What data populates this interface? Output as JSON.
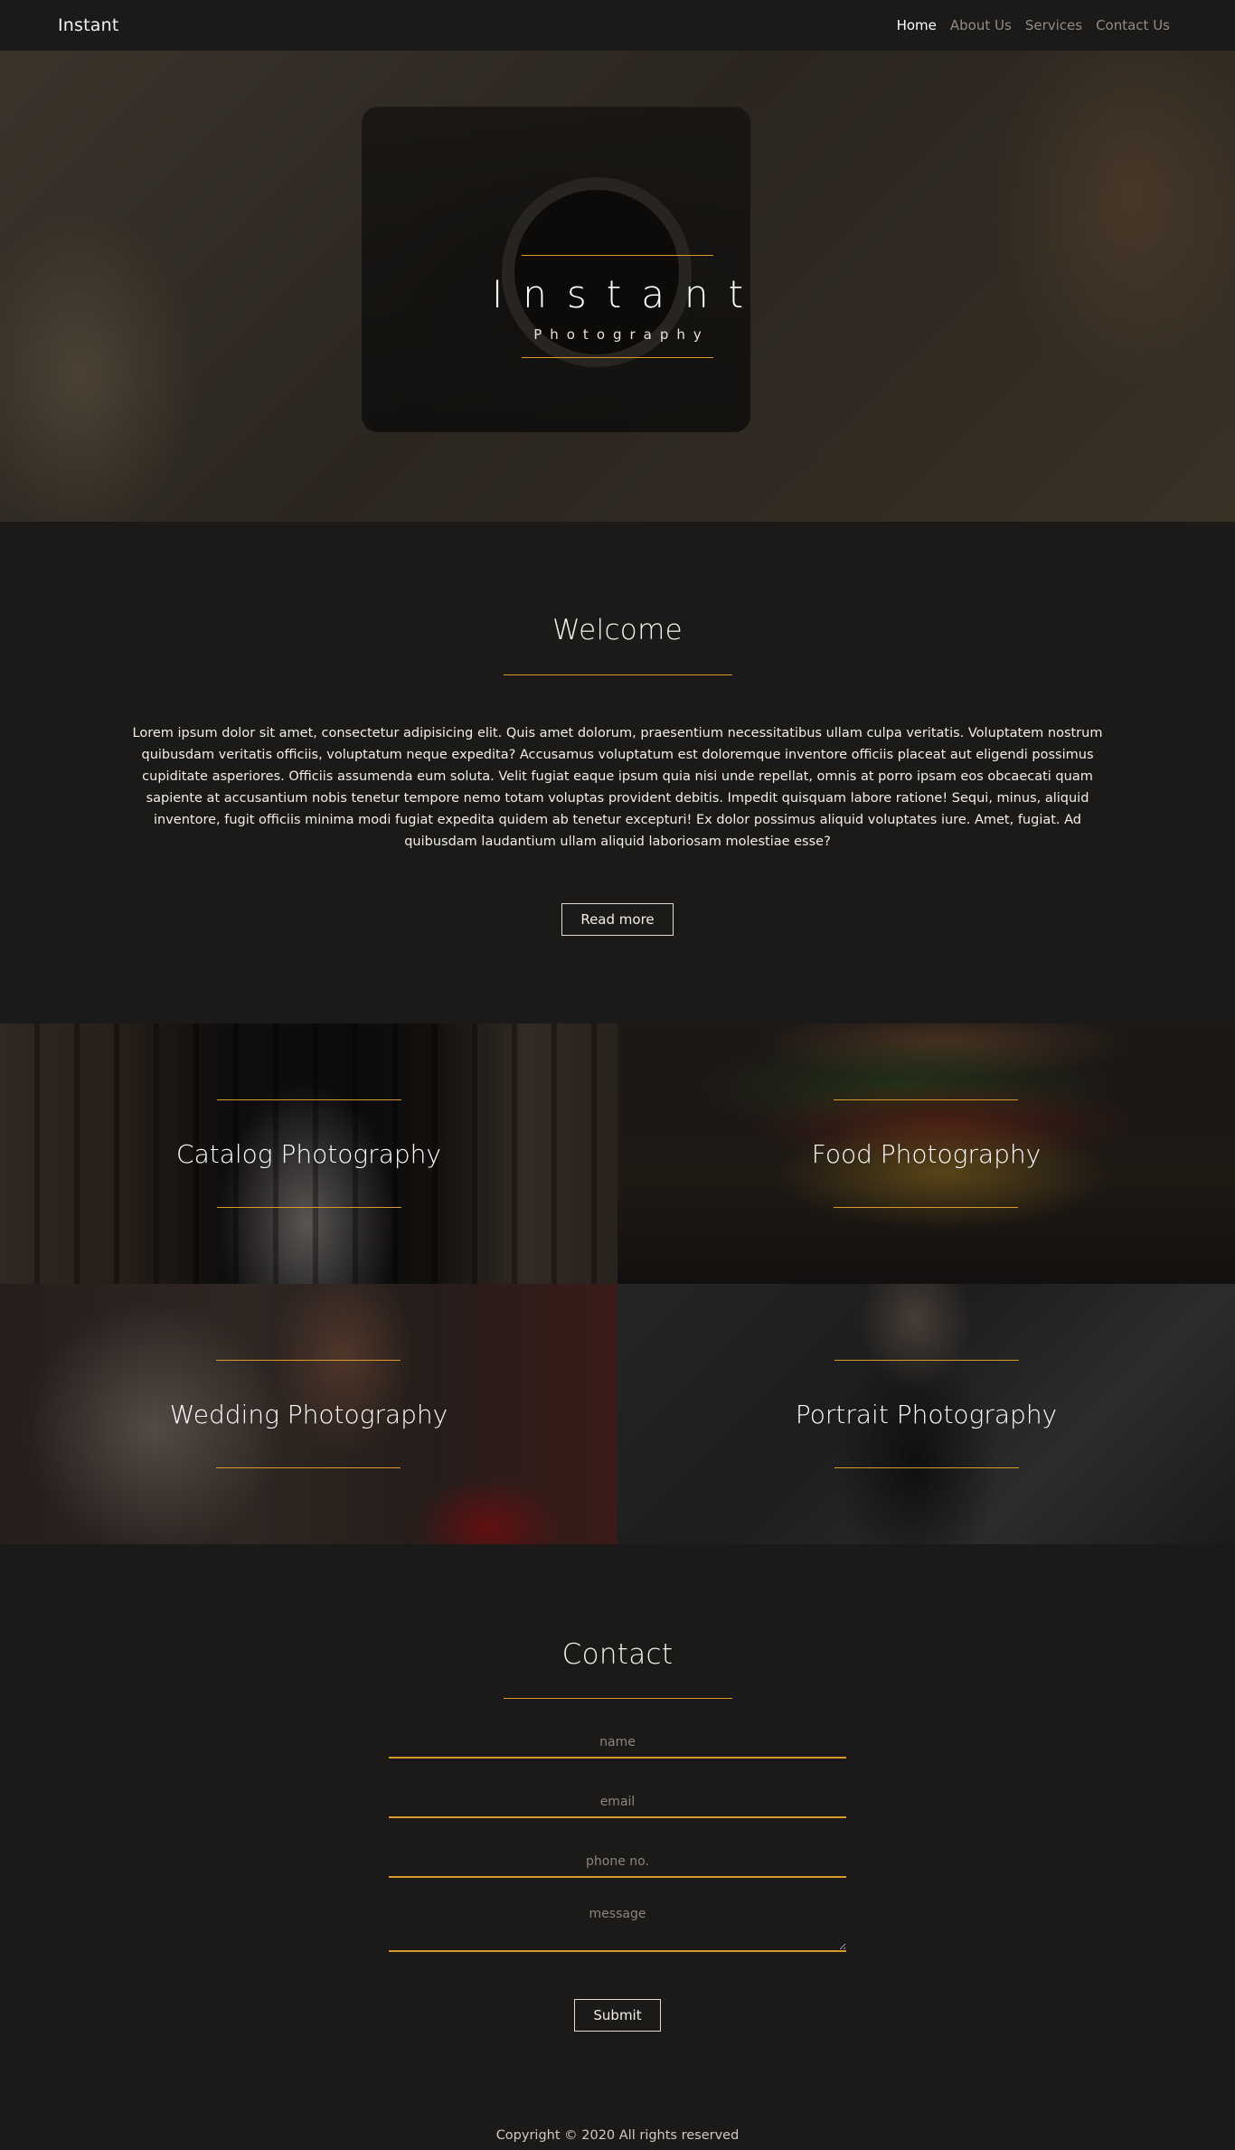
{
  "nav": {
    "brand": "Instant",
    "links": [
      {
        "label": "Home",
        "active": true
      },
      {
        "label": "About Us",
        "active": false
      },
      {
        "label": "Services",
        "active": false
      },
      {
        "label": "Contact Us",
        "active": false
      }
    ]
  },
  "hero": {
    "title": "Instant",
    "subtitle": "Photography"
  },
  "welcome": {
    "title": "Welcome",
    "body": "Lorem ipsum dolor sit amet, consectetur adipisicing elit. Quis amet dolorum, praesentium necessitatibus ullam culpa veritatis. Voluptatem nostrum quibusdam veritatis officiis, voluptatum neque expedita? Accusamus voluptatum est doloremque inventore officiis placeat aut eligendi possimus cupiditate asperiores. Officiis assumenda eum soluta. Velit fugiat eaque ipsum quia nisi unde repellat, omnis at porro ipsam eos obcaecati quam sapiente at accusantium nobis tenetur tempore nemo totam voluptas provident debitis. Impedit quisquam labore ratione! Sequi, minus, aliquid inventore, fugit officiis minima modi fugiat expedita quidem ab tenetur excepturi! Ex dolor possimus aliquid voluptates iure. Amet, fugiat. Ad quibusdam laudantium ullam aliquid laboriosam molestiae esse?",
    "button": "Read more"
  },
  "services": [
    {
      "title": "Catalog Photography"
    },
    {
      "title": "Food Photography"
    },
    {
      "title": "Wedding Photography"
    },
    {
      "title": "Portrait Photography"
    }
  ],
  "contact": {
    "title": "Contact",
    "placeholders": {
      "name": "name",
      "email": "email",
      "phone": "phone no.",
      "message": "message"
    },
    "submit": "Submit"
  },
  "footer": {
    "text": "Copyright © 2020 All rights reserved"
  },
  "colors": {
    "background": "#1b1a19",
    "accent": "#d99a2b"
  }
}
